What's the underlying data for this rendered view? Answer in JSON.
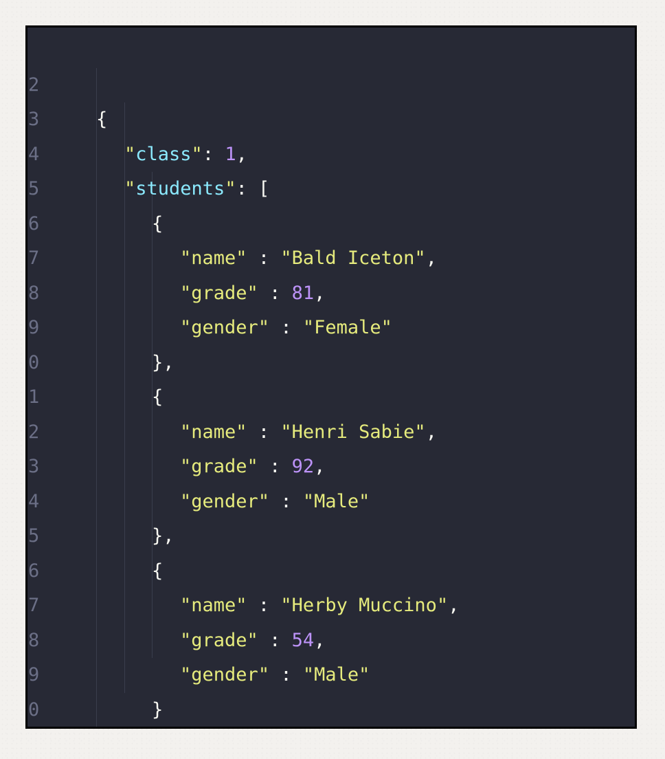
{
  "editor": {
    "lines": [
      {
        "num": "2"
      },
      {
        "num": "3",
        "key": "class",
        "value": "1"
      },
      {
        "num": "4",
        "key": "students"
      },
      {
        "num": "5"
      },
      {
        "num": "6",
        "key": "name",
        "value": "Bald Iceton"
      },
      {
        "num": "7",
        "key": "grade",
        "value": "81"
      },
      {
        "num": "8",
        "key": "gender",
        "value": "Female"
      },
      {
        "num": "9"
      },
      {
        "num": "0"
      },
      {
        "num": "1",
        "key": "name",
        "value": "Henri Sabie"
      },
      {
        "num": "2",
        "key": "grade",
        "value": "92"
      },
      {
        "num": "3",
        "key": "gender",
        "value": "Male"
      },
      {
        "num": "4"
      },
      {
        "num": "5"
      },
      {
        "num": "6",
        "key": "name",
        "value": "Herby Muccino"
      },
      {
        "num": "7",
        "key": "grade",
        "value": "54"
      },
      {
        "num": "8",
        "key": "gender",
        "value": "Male"
      },
      {
        "num": "9"
      },
      {
        "num": "0"
      },
      {
        "num": "1"
      }
    ]
  },
  "colors": {
    "background": "#272935",
    "string": "#e6eb7d",
    "key_accent": "#8be9fd",
    "number": "#bd93f9",
    "line_number": "#6b6f86"
  }
}
